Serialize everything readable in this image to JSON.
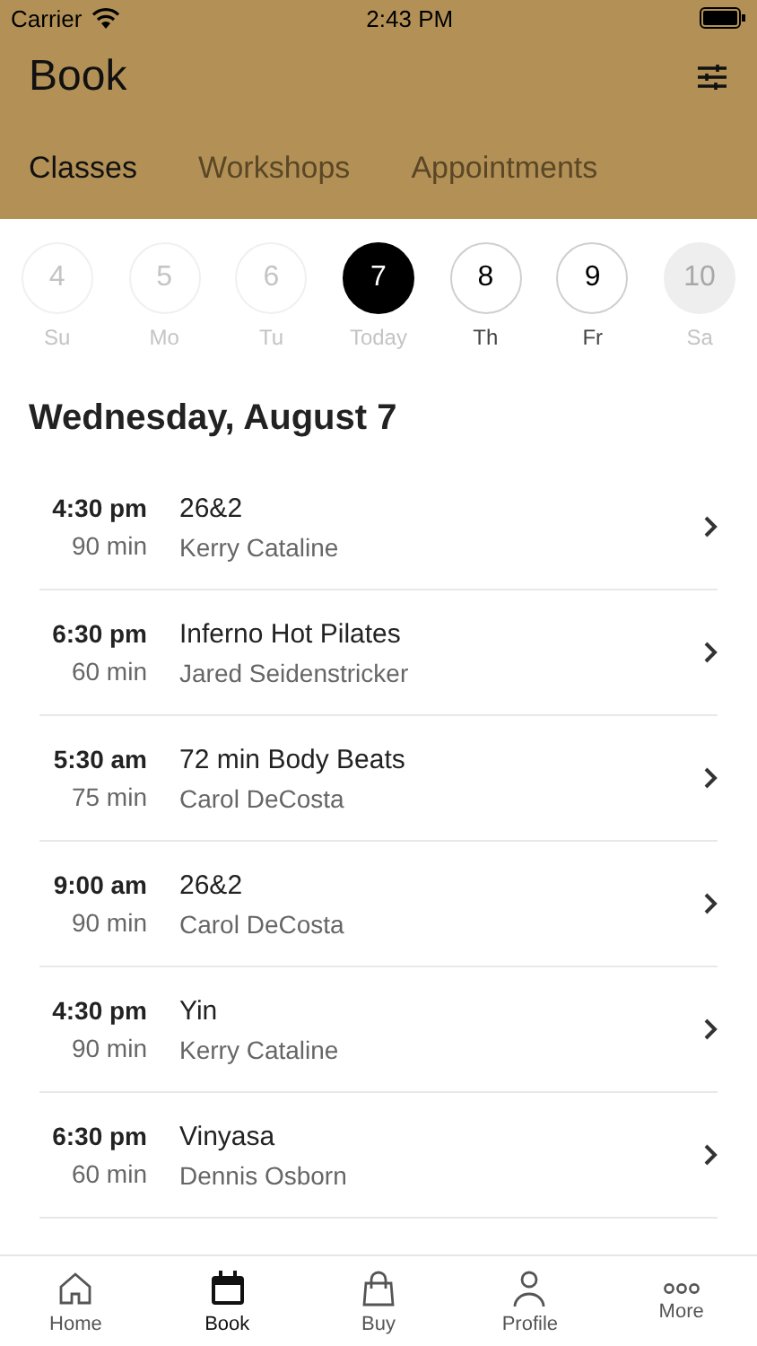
{
  "status_bar": {
    "carrier": "Carrier",
    "time": "2:43 PM"
  },
  "header": {
    "title": "Book"
  },
  "tabs": [
    {
      "label": "Classes",
      "selected": true
    },
    {
      "label": "Workshops",
      "selected": false
    },
    {
      "label": "Appointments",
      "selected": false
    }
  ],
  "days": [
    {
      "number": "4",
      "label": "Su",
      "kind": "past",
      "selected": false
    },
    {
      "number": "5",
      "label": "Mo",
      "kind": "past",
      "selected": false
    },
    {
      "number": "6",
      "label": "Tu",
      "kind": "past",
      "selected": false
    },
    {
      "number": "7",
      "label": "Today",
      "kind": "past",
      "selected": true
    },
    {
      "number": "8",
      "label": "Th",
      "kind": "available",
      "selected": false
    },
    {
      "number": "9",
      "label": "Fr",
      "kind": "available",
      "selected": false
    },
    {
      "number": "10",
      "label": "Sa",
      "kind": "unavailable",
      "selected": false
    }
  ],
  "date_heading": "Wednesday, August 7",
  "classes": [
    {
      "time": "4:30 pm",
      "duration": "90 min",
      "name": "26&2",
      "instructor": "Kerry Cataline"
    },
    {
      "time": "6:30 pm",
      "duration": "60 min",
      "name": "Inferno Hot Pilates",
      "instructor": "Jared Seidenstricker"
    },
    {
      "time": "5:30 am",
      "duration": "75 min",
      "name": "72 min Body Beats",
      "instructor": "Carol DeCosta"
    },
    {
      "time": "9:00 am",
      "duration": "90 min",
      "name": "26&2",
      "instructor": "Carol DeCosta"
    },
    {
      "time": "4:30 pm",
      "duration": "90 min",
      "name": "Yin",
      "instructor": "Kerry Cataline"
    },
    {
      "time": "6:30 pm",
      "duration": "60 min",
      "name": "Vinyasa",
      "instructor": "Dennis Osborn"
    }
  ],
  "tab_bar": [
    {
      "label": "Home",
      "selected": false
    },
    {
      "label": "Book",
      "selected": true
    },
    {
      "label": "Buy",
      "selected": false
    },
    {
      "label": "Profile",
      "selected": false
    },
    {
      "label": "More",
      "selected": false
    }
  ]
}
